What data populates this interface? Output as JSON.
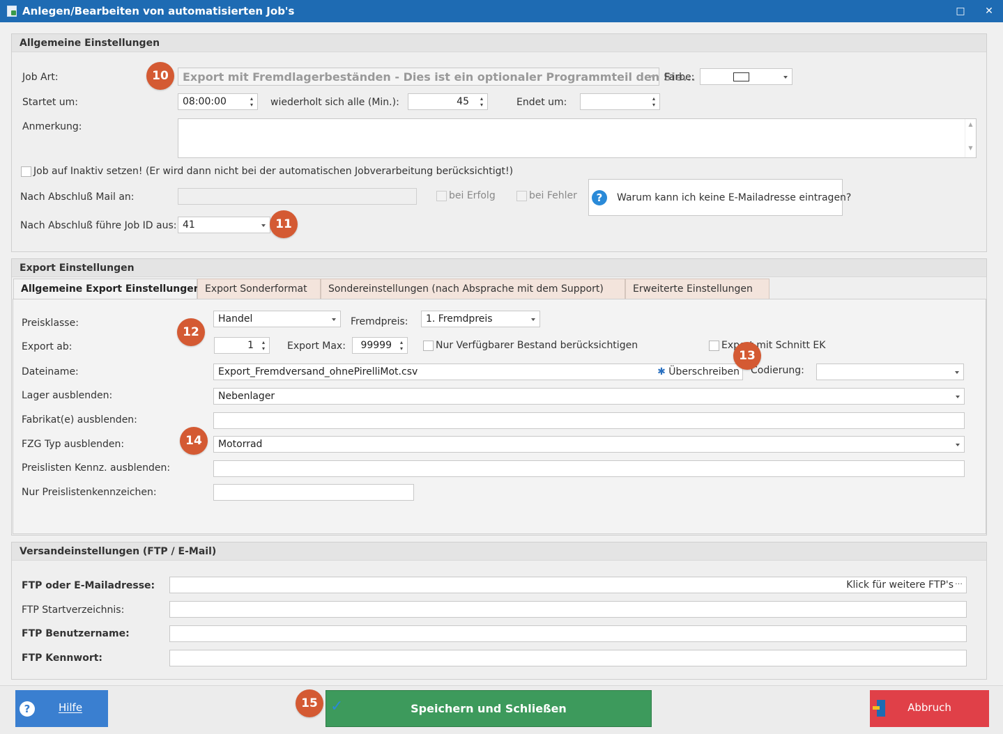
{
  "window": {
    "title": "Anlegen/Bearbeiten von automatisierten Job's",
    "maximize_glyph": "□",
    "close_glyph": "✕"
  },
  "general": {
    "heading": "Allgemeine Einstellungen",
    "job_art_label": "Job Art:",
    "job_art_value": "Export mit Fremdlagerbeständen - Dies ist ein optionaler Programmteil den Sie...",
    "farbe_label": "Farbe:",
    "startet_label": "Startet um:",
    "startet_value": "08:00:00",
    "wiederholt_label": "wiederholt sich alle (Min.):",
    "wiederholt_value": "45",
    "endet_label": "Endet um:",
    "endet_value": "",
    "anmerkung_label": "Anmerkung:",
    "anmerkung_value": "",
    "inaktiv_label": "Job auf Inaktiv setzen! (Er wird dann nicht bei der automatischen Jobverarbeitung berücksichtigt!)",
    "inaktiv_checked": false,
    "mail_label": "Nach Abschluß Mail an:",
    "mail_value": "",
    "bei_erfolg_label": "bei Erfolg",
    "bei_fehler_label": "bei Fehler",
    "help_text": "Warum kann ich keine E-Mailadresse eintragen?",
    "job_id_label": "Nach Abschluß führe Job ID aus:",
    "job_id_value": "41"
  },
  "export": {
    "heading": "Export Einstellungen",
    "tabs": [
      {
        "label": "Allgemeine Export Einstellungen",
        "active": true
      },
      {
        "label": "Export Sonderformat",
        "active": false
      },
      {
        "label": "Sondereinstellungen (nach Absprache mit dem Support)",
        "active": false
      },
      {
        "label": "Erweiterte Einstellungen",
        "active": false
      }
    ],
    "preisklasse_label": "Preisklasse:",
    "preisklasse_value": "Handel",
    "fremdpreis_label": "Fremdpreis:",
    "fremdpreis_value": "1. Fremdpreis",
    "export_ab_label": "Export ab:",
    "export_ab_value": "1",
    "export_max_label": "Export Max:",
    "export_max_value": "99999",
    "nur_verfuegbar_label": "Nur Verfügbarer Bestand berücksichtigen",
    "schnitt_ek_label": "Export mit Schnitt EK",
    "dateiname_label": "Dateiname:",
    "dateiname_value": "Export_Fremdversand_ohnePirelliMot.csv",
    "ueberschreiben_label": "Überschreiben",
    "codierung_label": "Codierung:",
    "codierung_value": "",
    "lager_label": "Lager ausblenden:",
    "lager_value": "Nebenlager",
    "fabrikat_label": "Fabrikat(e) ausblenden:",
    "fabrikat_value": "",
    "fzg_label": "FZG Typ  ausblenden:",
    "fzg_value": "Motorrad",
    "preislisten_label": "Preislisten Kennz. ausblenden:",
    "preislisten_value": "",
    "nur_preislisten_label": "Nur Preislistenkennzeichen:",
    "nur_preislisten_value": ""
  },
  "versand": {
    "heading": "Versandeinstellungen (FTP / E-Mail)",
    "ftp_label": "FTP oder E-Mailadresse:",
    "ftp_value": "",
    "ftp_more": "Klick für weitere FTP's",
    "startverz_label": "FTP Startverzeichnis:",
    "startverz_value": "",
    "benutzer_label": "FTP Benutzername:",
    "benutzer_value": "",
    "kennwort_label": "FTP Kennwort:",
    "kennwort_value": ""
  },
  "footer": {
    "hilfe": "Hilfe",
    "speichern": "Speichern und Schließen",
    "abbruch": "Abbruch"
  },
  "badges": {
    "b10": "10",
    "b11": "11",
    "b12": "12",
    "b13": "13",
    "b14": "14",
    "b15": "15"
  },
  "colors": {
    "titlebar": "#1e6bb3",
    "badge": "#d45a33",
    "hilfe_button": "#3a7fd0",
    "save_button": "#3d9a5c",
    "cancel_button": "#e04048"
  },
  "icons": {
    "question": "help-icon",
    "gear": "gear-icon",
    "check": "checkmark-icon",
    "exit": "exit-door-icon"
  }
}
